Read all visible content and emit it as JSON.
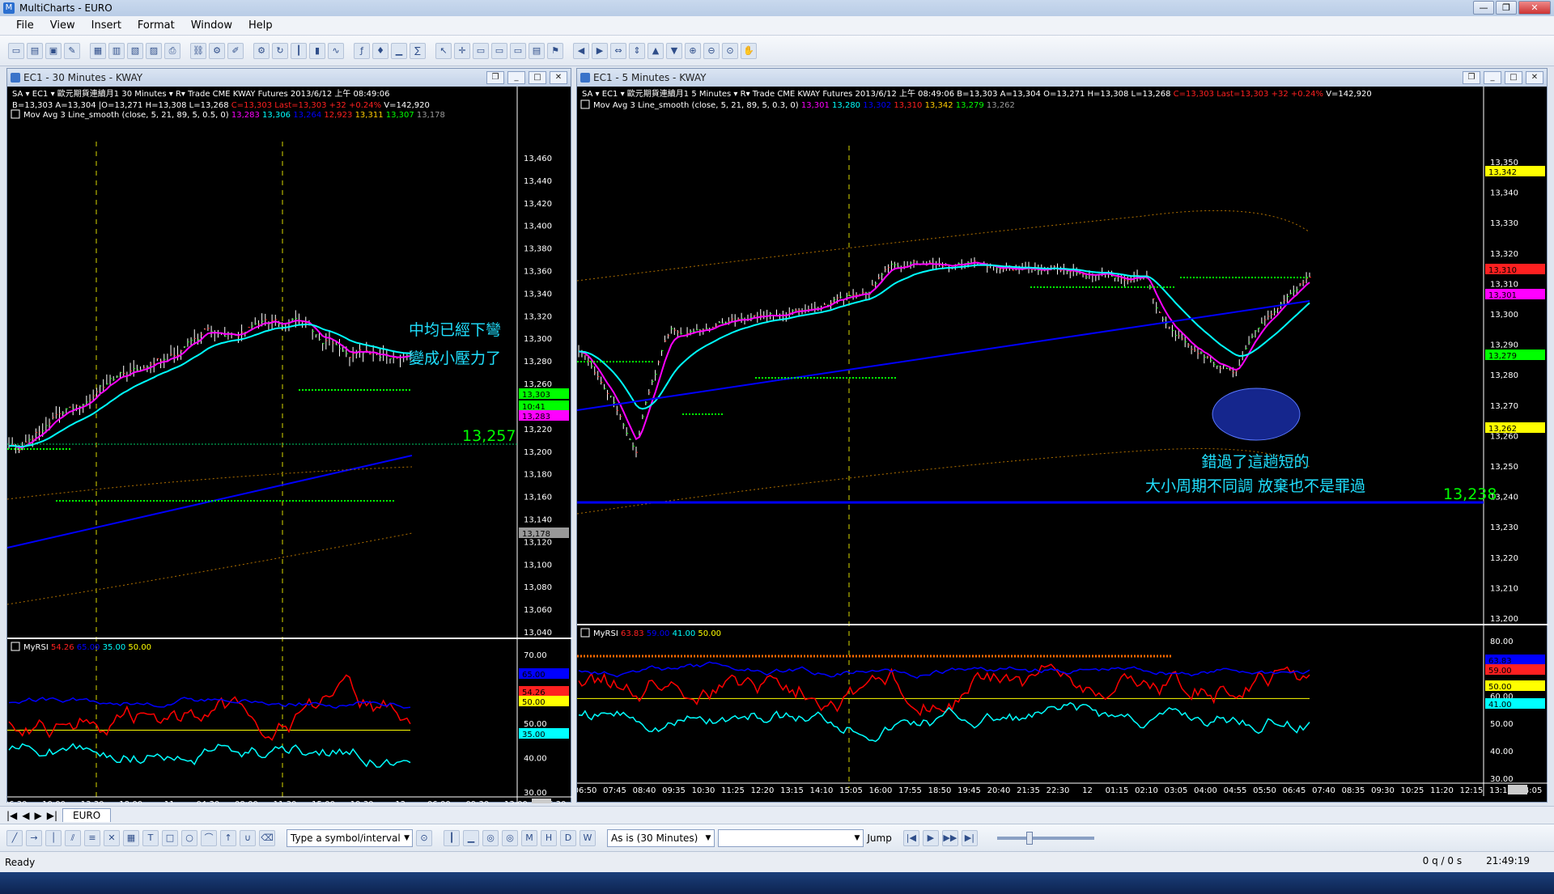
{
  "app": {
    "title": "MultiCharts - EURO"
  },
  "menu": [
    "File",
    "View",
    "Insert",
    "Format",
    "Window",
    "Help"
  ],
  "colors": {
    "bg": "#000000",
    "price": "#ffffff",
    "ma_fast": "#ff00ff",
    "ma_mid": "#00ffff",
    "ma_slow": "#0000ff",
    "rsi": "#ff0000",
    "rsi_avg": "#0000ff",
    "rsi_ref": "#00ffff",
    "yellow_line": "#ffff00",
    "green_level": "#00ff00",
    "axis_text": "#ffffff"
  },
  "left": {
    "title": "EC1 - 30 Minutes - KWAY",
    "header1": "SA ▾  EC1 ▾  歐元期貨連續月1  30 Minutes ▾  R▾  Trade  CME  KWAY  Futures  2013/6/12 上午 08:49:06",
    "header2_ohlc": "B=13,303  A=13,304 |O=13,271  H=13,308  L=13,268",
    "header2_close": "C=13,303",
    "header2_last": "Last=13,303  +32  +0.24%",
    "header2_vol": "V=142,920",
    "study": "Mov Avg 3 Line_smooth  (close,  5,  21,  89,  5,  0.5,  0)",
    "study_vals": [
      "13,283",
      "13,306",
      "13,264",
      "12,923",
      "13,311",
      "13,307",
      "13,178"
    ],
    "annotation1": "中均已經下彎",
    "annotation2": "變成小壓力了",
    "level_label": "13,257",
    "price_ticks": [
      "13,460",
      "13,440",
      "13,420",
      "13,400",
      "13,380",
      "13,360",
      "13,340",
      "13,320",
      "13,300",
      "13,280",
      "13,260",
      "13,240",
      "13,220",
      "13,200",
      "13,180",
      "13,160",
      "13,140",
      "13,120",
      "13,100",
      "13,080",
      "13,060",
      "13,040"
    ],
    "price_tags": [
      "13,303",
      "10:41",
      "13,283",
      "13,178"
    ],
    "rsi_title": "MyRSI",
    "rsi_vals": [
      "54.26",
      "65.00",
      "35.00",
      "50.00"
    ],
    "rsi_ticks": [
      "70.00",
      "60.00",
      "50.00",
      "40.00",
      "30.00"
    ],
    "rsi_tags": [
      "65.00",
      "54.26",
      "50.00",
      "35.00"
    ],
    "time_ticks": [
      "06:30",
      "10:00",
      "13:30",
      "18:00",
      "11",
      "04:30",
      "08:00",
      "11:30",
      "15:00",
      "19:30",
      "12",
      "06:00",
      "09:30",
      "13:00",
      "16:30"
    ]
  },
  "right": {
    "title": "EC1 - 5 Minutes - KWAY",
    "header1": "SA ▾  EC1 ▾  歐元期貨連續月1  5 Minutes ▾  R▾  Trade  CME  KWAY  Futures  2013/6/12 上午 08:49:06  B=13,303  A=13,304  O=13,271  H=13,308  L=13,268",
    "header1_close": "C=13,303",
    "header1_last": "Last=13,303  +32  +0.24%",
    "header1_vol": "V=142,920",
    "study": "Mov Avg 3 Line_smooth  (close,  5,  21,  89,  5,  0.3,  0)",
    "study_vals": [
      "13,301",
      "13,280",
      "13,302",
      "13,310",
      "13,342",
      "13,279",
      "13,262"
    ],
    "annotation1": "錯過了這趟短的",
    "annotation2": "大小周期不同調 放棄也不是罪過",
    "level_label": "13,238",
    "price_ticks": [
      "13,350",
      "13,340",
      "13,330",
      "13,320",
      "13,310",
      "13,300",
      "13,290",
      "13,280",
      "13,270",
      "13,260",
      "13,250",
      "13,240",
      "13,230",
      "13,220",
      "13,210",
      "13,200"
    ],
    "price_tags": [
      "13,342",
      "13,310",
      "13,301",
      "13,279",
      "13,262"
    ],
    "rsi_title": "MyRSI",
    "rsi_vals": [
      "63.83",
      "59.00",
      "41.00",
      "50.00"
    ],
    "rsi_ticks": [
      "80.00",
      "70.00",
      "60.00",
      "50.00",
      "40.00",
      "30.00"
    ],
    "rsi_tags": [
      "63.83",
      "59.00",
      "50.00",
      "41.00"
    ],
    "time_ticks": [
      "06:50",
      "07:45",
      "08:40",
      "09:35",
      "10:30",
      "11:25",
      "12:20",
      "13:15",
      "14:10",
      "15:05",
      "16:00",
      "17:55",
      "18:50",
      "19:45",
      "20:40",
      "21:35",
      "22:30",
      "12",
      "01:15",
      "02:10",
      "03:05",
      "04:00",
      "04:55",
      "05:50",
      "06:45",
      "07:40",
      "08:35",
      "09:30",
      "10:25",
      "11:20",
      "12:15",
      "13:10",
      "14:05"
    ]
  },
  "bottom": {
    "sheet_tab": "EURO",
    "symbol_placeholder": "Type a symbol/interval",
    "interval": "As is (30 Minutes)",
    "jump": "Jump",
    "status": "Ready",
    "queue": "0 q / 0 s",
    "clock": "21:49:19"
  }
}
